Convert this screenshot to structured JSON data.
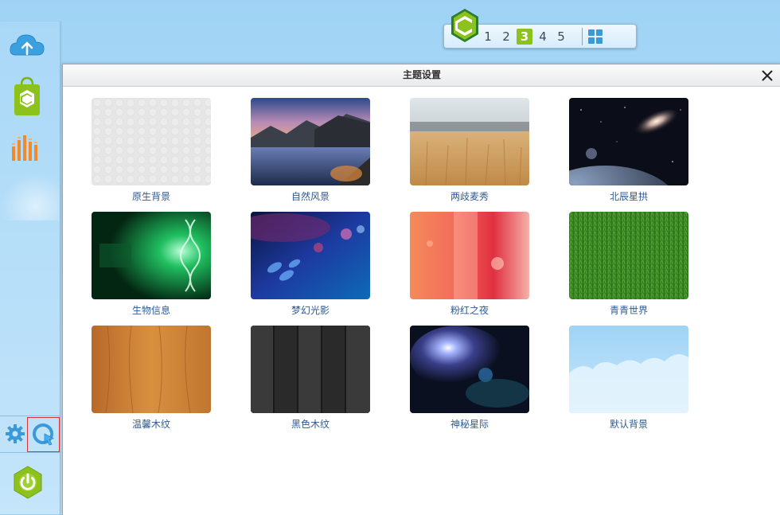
{
  "dialog": {
    "title": "主题设置",
    "close_icon": "close-icon"
  },
  "pager": {
    "pages": [
      "1",
      "2",
      "3",
      "4",
      "5"
    ],
    "active_page": "3",
    "logo_icon": "app-logo-icon",
    "grid_icon": "grid-view-icon",
    "accent": "#8cc21b"
  },
  "dock": {
    "items": [
      {
        "name": "cloud-upload-icon"
      },
      {
        "name": "app-store-icon"
      },
      {
        "name": "equalizer-icon"
      }
    ],
    "bottom": [
      {
        "name": "gear-icon"
      },
      {
        "name": "theme-switch-icon"
      },
      {
        "name": "power-icon"
      }
    ]
  },
  "themes": [
    {
      "label": "原生背景"
    },
    {
      "label": "自然风景"
    },
    {
      "label": "两歧麦秀"
    },
    {
      "label": "北辰星拱"
    },
    {
      "label": "生物信息"
    },
    {
      "label": "梦幻光影"
    },
    {
      "label": "粉红之夜"
    },
    {
      "label": "青青世界"
    },
    {
      "label": "温馨木纹"
    },
    {
      "label": "黑色木纹"
    },
    {
      "label": "神秘星际"
    },
    {
      "label": "默认背景"
    }
  ]
}
